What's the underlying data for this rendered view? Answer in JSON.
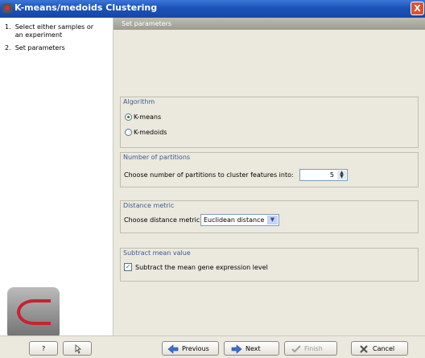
{
  "window": {
    "title": "K-means/medoids Clustering",
    "close_glyph": "X"
  },
  "sidebar": {
    "steps": [
      {
        "label": "1.  Select either samples or\n     an experiment"
      },
      {
        "label": "2.  Set parameters"
      }
    ]
  },
  "main": {
    "header": "Set parameters",
    "algorithm": {
      "title": "Algorithm",
      "options": [
        {
          "label": "K-means",
          "selected": true
        },
        {
          "label": "K-medoids",
          "selected": false
        }
      ]
    },
    "partitions": {
      "title": "Number of partitions",
      "label": "Choose number of partitions to cluster features into:",
      "value": "5"
    },
    "distance": {
      "title": "Distance metric",
      "label": "Choose distance metric:",
      "value": "Euclidean distance"
    },
    "subtract": {
      "title": "Subtract mean value",
      "label": "Subtract the mean gene expression level",
      "checked": true
    }
  },
  "buttons": {
    "help": "?",
    "previous": "Previous",
    "next": "Next",
    "finish": "Finish",
    "cancel": "Cancel"
  }
}
